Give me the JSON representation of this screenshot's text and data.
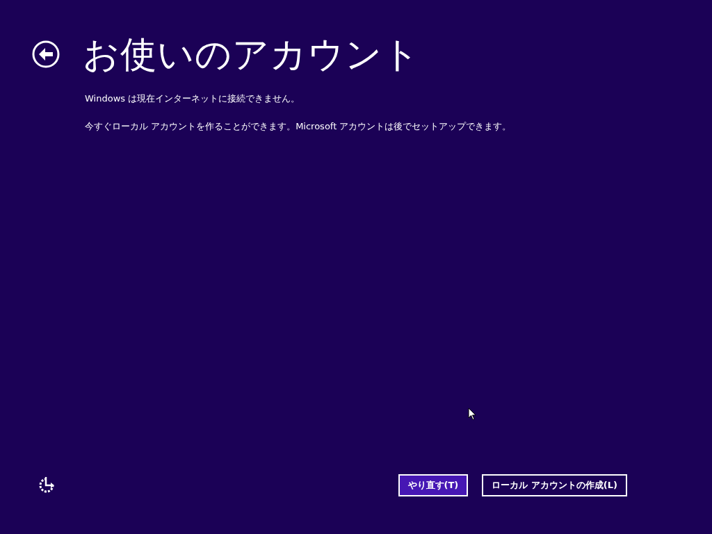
{
  "title": "お使いのアカウント",
  "messages": [
    "Windows は現在インターネットに接続できません。",
    "今すぐローカル アカウントを作ることができます。Microsoft アカウントは後でセットアップできます。"
  ],
  "buttons": [
    {
      "label": "やり直す(T)",
      "kind": "primary"
    },
    {
      "label": "ローカル アカウントの作成(L)",
      "kind": "secondary"
    }
  ]
}
